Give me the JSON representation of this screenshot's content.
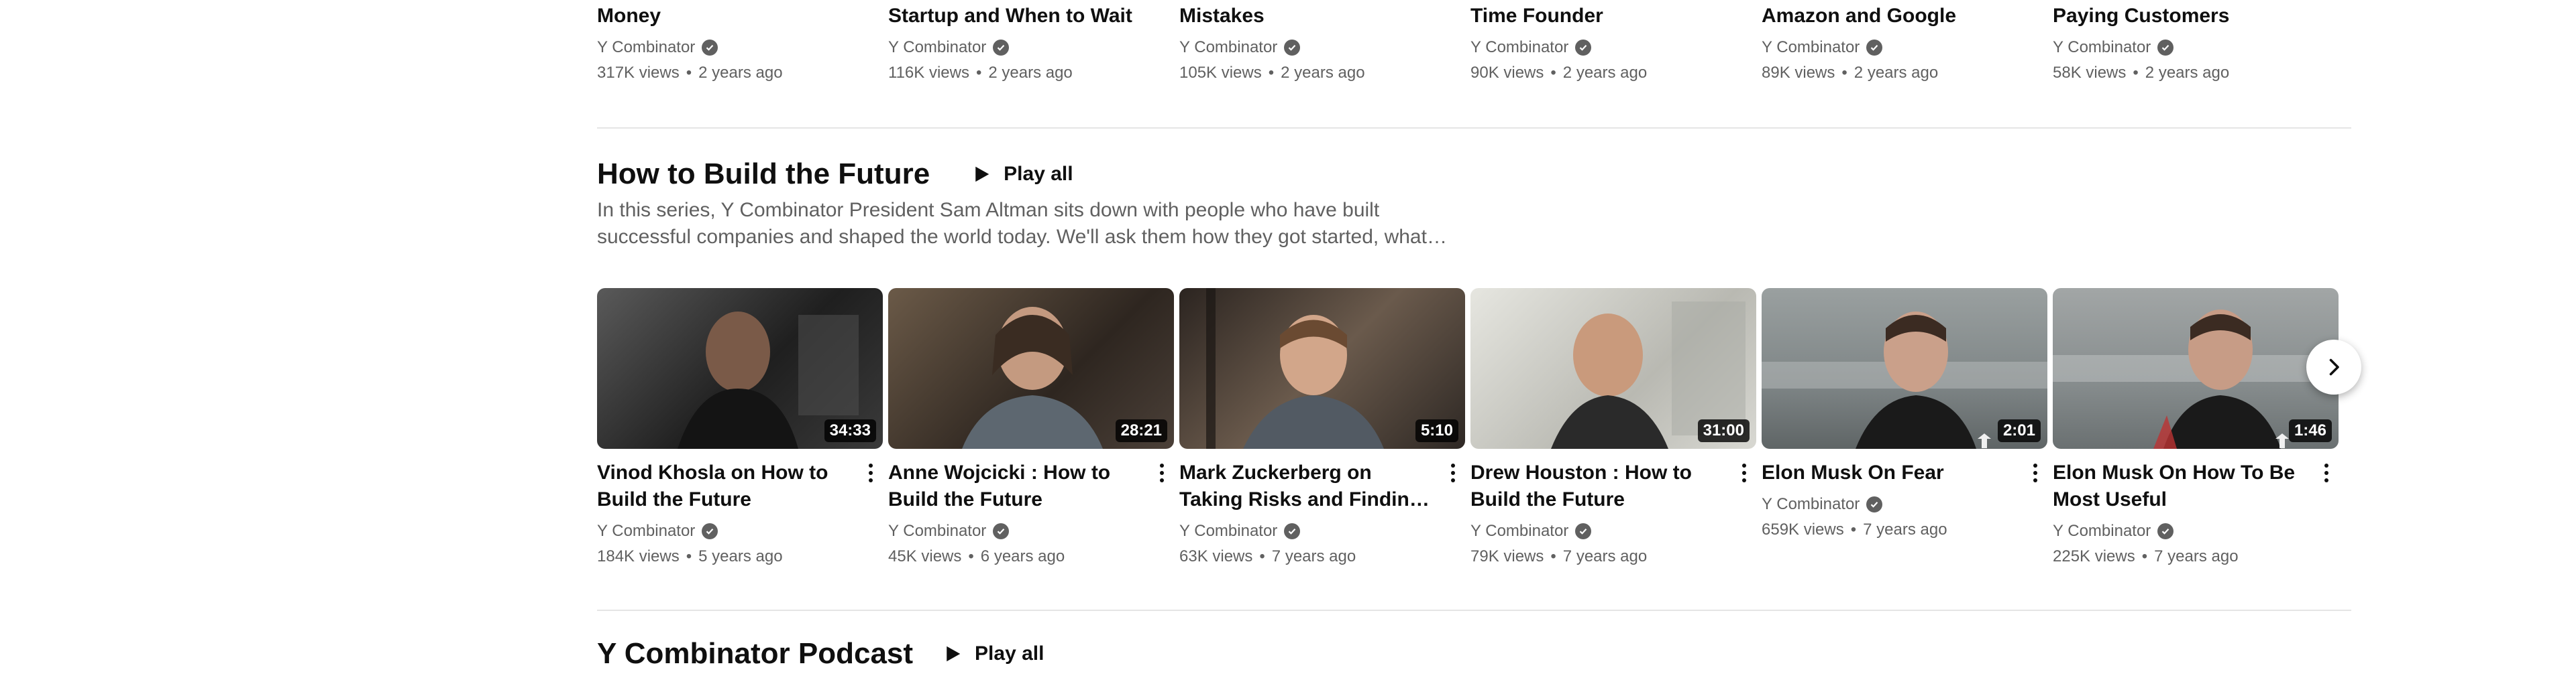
{
  "top_row": [
    {
      "title": "Top Ways Startups Waste Money",
      "channel": "Y Combinator",
      "views": "317K views",
      "age": "2 years ago"
    },
    {
      "title": "When to Launch Your Startup and When to Wait",
      "channel": "Y Combinator",
      "views": "116K views",
      "age": "2 years ago"
    },
    {
      "title": "Don't Make These Hiring Mistakes",
      "channel": "Y Combinator",
      "views": "105K views",
      "age": "2 years ago"
    },
    {
      "title": "Advantages Of A First-Time Founder",
      "channel": "Y Combinator",
      "views": "90K views",
      "age": "2 years ago"
    },
    {
      "title": "How To Compete With Amazon and Google",
      "channel": "Y Combinator",
      "views": "89K views",
      "age": "2 years ago"
    },
    {
      "title": "Turning Your Users Into Paying Customers",
      "channel": "Y Combinator",
      "views": "58K views",
      "age": "2 years ago"
    }
  ],
  "section": {
    "title": "How to Build the Future",
    "play_all": "Play all",
    "description": "In this series, Y Combinator President Sam Altman sits down with people who have built successful companies and shaped the world today. We'll ask them how they got started, what they think the…"
  },
  "videos": [
    {
      "title": "Vinod Khosla on How to Build the Future",
      "channel": "Y Combinator",
      "views": "184K views",
      "age": "5 years ago",
      "duration": "34:33",
      "thumb_bg": "#2b2b2b"
    },
    {
      "title": "Anne Wojcicki : How to Build the Future",
      "channel": "Y Combinator",
      "views": "45K views",
      "age": "6 years ago",
      "duration": "28:21",
      "thumb_bg": "#3d342c"
    },
    {
      "title": "Mark Zuckerberg on Taking Risks and Finding Talented…",
      "channel": "Y Combinator",
      "views": "63K views",
      "age": "7 years ago",
      "duration": "5:10",
      "thumb_bg": "#4a3f36"
    },
    {
      "title": "Drew Houston : How to Build the Future",
      "channel": "Y Combinator",
      "views": "79K views",
      "age": "7 years ago",
      "duration": "31:00",
      "thumb_bg": "#c9c9c3"
    },
    {
      "title": "Elon Musk On Fear",
      "channel": "Y Combinator",
      "views": "659K views",
      "age": "7 years ago",
      "duration": "2:01",
      "thumb_bg": "#8a8e8f"
    },
    {
      "title": "Elon Musk On How To Be Most Useful",
      "channel": "Y Combinator",
      "views": "225K views",
      "age": "7 years ago",
      "duration": "1:46",
      "thumb_bg": "#7c8284"
    }
  ],
  "next_section": {
    "title": "Y Combinator Podcast",
    "play_all": "Play all"
  },
  "icons": {
    "verified": "verified-check-icon",
    "more": "more-vert-icon",
    "play": "play-icon",
    "next": "chevron-right-icon"
  }
}
